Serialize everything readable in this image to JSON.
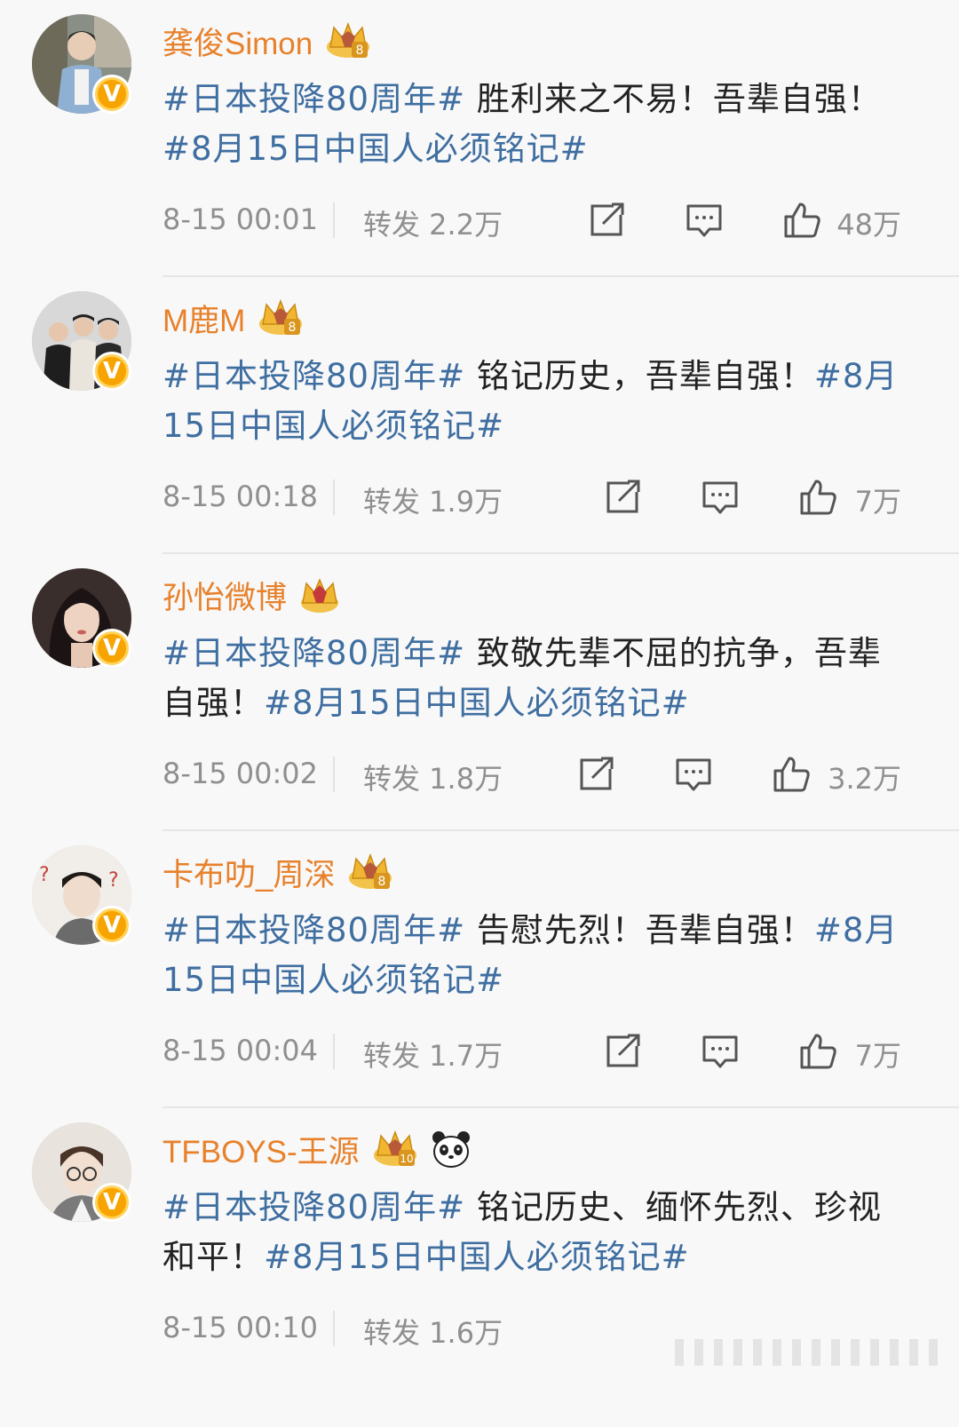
{
  "posts": [
    {
      "username": "龚俊Simon",
      "badge_icon": "crown-level-icon",
      "text_tag1": "#日本投降80周年#",
      "text_body": " 胜利来之不易！吾辈自强！",
      "text_tag2": "#8月15日中国人必须铭记#",
      "time": "8-15 00:01",
      "repost": "转发 2.2万",
      "likes": "48万",
      "verified": "V"
    },
    {
      "username": "M鹿M",
      "badge_icon": "crown-level-icon",
      "text_tag1": "#日本投降80周年#",
      "text_body": " 铭记历史，吾辈自强！",
      "text_tag2": "#8月15日中国人必须铭记#",
      "time": "8-15 00:18",
      "repost": "转发 1.9万",
      "likes": "7万",
      "verified": "V"
    },
    {
      "username": "孙怡微博",
      "badge_icon": "crown-icon",
      "text_tag1": "#日本投降80周年#",
      "text_body": " 致敬先辈不屈的抗争，吾辈自强！",
      "text_tag2": "#8月15日中国人必须铭记#",
      "time": "8-15 00:02",
      "repost": "转发 1.8万",
      "likes": "3.2万",
      "verified": "V"
    },
    {
      "username": "卡布叻_周深",
      "badge_icon": "crown-level-icon",
      "text_tag1": "#日本投降80周年#",
      "text_body": " 告慰先烈！吾辈自强！",
      "text_tag2": "#8月15日中国人必须铭记#",
      "time": "8-15 00:04",
      "repost": "转发 1.7万",
      "likes": "7万",
      "verified": "V"
    },
    {
      "username": "TFBOYS-王源",
      "badge_icon": "crown-level-icon",
      "extra_icon": "panda-icon",
      "text_tag1": "#日本投降80周年#",
      "text_body": " 铭记历史、缅怀先烈、珍视和平！",
      "text_tag2": "#8月15日中国人必须铭记#",
      "time": "8-15 00:10",
      "repost": "转发 1.6万",
      "verified": "V"
    }
  ],
  "icons": {
    "share": "share-icon",
    "comment": "comment-icon",
    "like": "thumbs-up-icon"
  },
  "colors": {
    "username": "#e7812b",
    "hashtag": "#3f6ea1",
    "meta": "#8f8f8f",
    "verified": "#f7a400",
    "background": "#f8f8f8"
  }
}
